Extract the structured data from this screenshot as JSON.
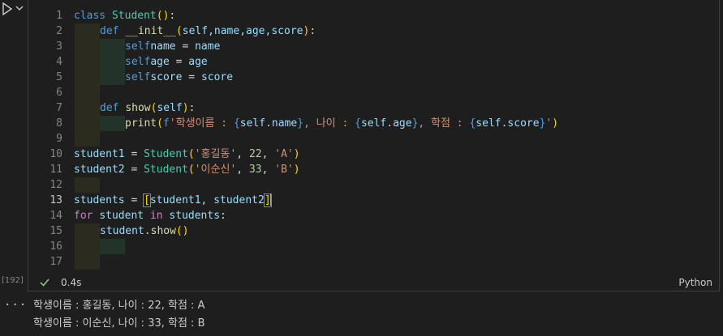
{
  "cell": {
    "execution_count": "[192]",
    "exec_time": "0.4s",
    "language": "Python",
    "lines": [
      {
        "n": "1"
      },
      {
        "n": "2"
      },
      {
        "n": "3"
      },
      {
        "n": "4"
      },
      {
        "n": "5"
      },
      {
        "n": "6"
      },
      {
        "n": "7"
      },
      {
        "n": "8"
      },
      {
        "n": "9"
      },
      {
        "n": "10"
      },
      {
        "n": "11"
      },
      {
        "n": "12"
      },
      {
        "n": "13"
      },
      {
        "n": "14"
      },
      {
        "n": "15"
      },
      {
        "n": "16"
      },
      {
        "n": "17"
      }
    ],
    "code": {
      "l1": {
        "kw": "class",
        "name": "Student",
        "paren": "()",
        "colon": ":"
      },
      "l2": {
        "kw": "def",
        "fn": "__init__",
        "p_open": "(",
        "params": "self,name,age,score",
        "p_close": ")",
        "colon": ":"
      },
      "l3": {
        "self": "self",
        ".": ".",
        "attr": "name",
        "eq": " = ",
        "val": "name"
      },
      "l4": {
        "self": "self",
        ".": ".",
        "attr": "age",
        "eq": " = ",
        "val": "age"
      },
      "l5": {
        "self": "self",
        ".": ".",
        "attr": "score",
        "eq": " = ",
        "val": "score"
      },
      "l7": {
        "kw": "def",
        "fn": "show",
        "p_open": "(",
        "params": "self",
        "p_close": ")",
        "colon": ":"
      },
      "l8": {
        "fn": "print",
        "p_open": "(",
        "fprefix": "f",
        "q1": "'",
        "s1": "학생이름 : ",
        "b1o": "{",
        "e1": "self.name",
        "b1c": "}",
        "s2": ", 나이 : ",
        "b2o": "{",
        "e2": "self.age",
        "b2c": "}",
        "s3": ", 학점 : ",
        "b3o": "{",
        "e3": "self.score",
        "b3c": "}",
        "q2": "'",
        "p_close": ")"
      },
      "l10": {
        "var": "student1",
        "eq": " = ",
        "cls": "Student",
        "p_open": "(",
        "s": "'홍길동'",
        "c1": ", ",
        "num": "22",
        "c2": ", ",
        "g": "'A'",
        "p_close": ")"
      },
      "l11": {
        "var": "student2",
        "eq": " = ",
        "cls": "Student",
        "p_open": "(",
        "s": "'이순신'",
        "c1": ", ",
        "num": "33",
        "c2": ", ",
        "g": "'B'",
        "p_close": ")"
      },
      "l13": {
        "var": "students",
        "eq": " = ",
        "b_open": "[",
        "items": "student1, student2",
        "b_close": "]"
      },
      "l14": {
        "kw1": "for",
        "v": "student",
        "kw2": "in",
        "it": "students",
        "colon": ":"
      },
      "l15": {
        "obj": "student",
        "dot": ".",
        "fn": "show",
        "paren": "()"
      }
    }
  },
  "output": {
    "more": "···",
    "lines": [
      "학생이름 : 홍길동, 나이 : 22, 학점 : A",
      "학생이름 : 이순신, 나이 : 33, 학점 : B"
    ]
  },
  "colors": {
    "background": "#1e1e1e",
    "keyword": "#569cd6",
    "class": "#4ec9b0",
    "function": "#dcdcaa",
    "string": "#ce9178",
    "number": "#b5cea8",
    "control": "#c586c0"
  },
  "icons": [
    "run-icon",
    "chevron-down-icon",
    "check-icon",
    "more-icon"
  ]
}
